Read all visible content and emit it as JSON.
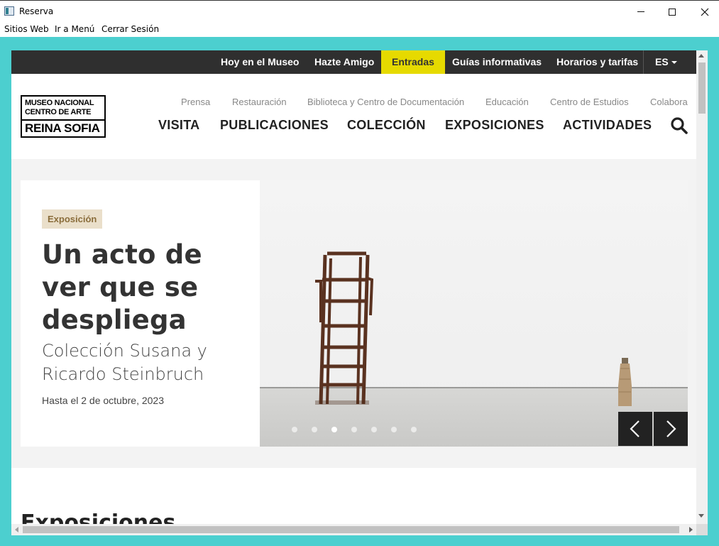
{
  "window": {
    "title": "Reserva",
    "menu": [
      "Sitios Web",
      "Ir a Menú",
      "Cerrar Sesión"
    ]
  },
  "topbar": {
    "links": [
      "Hoy en el Museo",
      "Hazte Amigo",
      "Entradas",
      "Guías informativas",
      "Horarios y tarifas"
    ],
    "active": "Entradas",
    "active_color": "#e6da00",
    "language": "ES"
  },
  "logo": {
    "line1": "MUSEO NACIONAL",
    "line2": "CENTRO DE ARTE",
    "line3": "REINA SOFIA"
  },
  "subnav": [
    "Prensa",
    "Restauración",
    "Biblioteca y Centro de Documentación",
    "Educación",
    "Centro de Estudios",
    "Colabora"
  ],
  "mainnav": [
    "VISITA",
    "PUBLICACIONES",
    "COLECCIÓN",
    "EXPOSICIONES",
    "ACTIVIDADES"
  ],
  "hero": {
    "badge": "Exposición",
    "title": "Un acto de ver que se despliega",
    "subtitle": "Colección Susana y Ricardo Steinbruch",
    "date": "Hasta el 2 de octubre, 2023",
    "slides_total": 7,
    "active_slide": 3
  },
  "section": {
    "title": "Exposiciones"
  },
  "icons": {
    "search": "search-icon",
    "prev": "chevron-left-icon",
    "next": "chevron-right-icon",
    "language_dropdown": "caret-down-icon"
  }
}
